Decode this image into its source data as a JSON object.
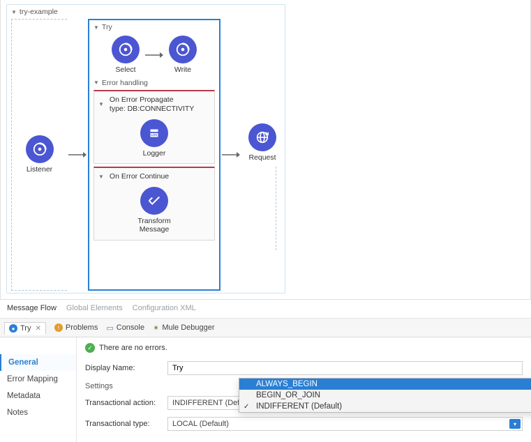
{
  "flow": {
    "name": "try-example",
    "listener_label": "Listener",
    "try_label": "Try",
    "select_label": "Select",
    "write_label": "Write",
    "error_handling_label": "Error handling",
    "on_error_propagate": {
      "title": "On Error Propagate",
      "type": "type: DB:CONNECTIVITY",
      "comp_label": "Logger"
    },
    "on_error_continue": {
      "title": "On Error Continue",
      "comp_label": "Transform\nMessage"
    },
    "request_label": "Request"
  },
  "bottom_tabs": {
    "t1": "Message Flow",
    "t2": "Global Elements",
    "t3": "Configuration XML"
  },
  "lower_tabs": {
    "try": "Try",
    "problems": "Problems",
    "console": "Console",
    "debugger": "Mule Debugger"
  },
  "status": {
    "msg": "There are no errors."
  },
  "side": {
    "general": "General",
    "error_mapping": "Error Mapping",
    "metadata": "Metadata",
    "notes": "Notes"
  },
  "form": {
    "display_name_lbl": "Display Name:",
    "display_name_val": "Try",
    "settings_lbl": "Settings",
    "tx_action_lbl": "Transactional action:",
    "tx_action_val": "INDIFFERENT (Default)",
    "tx_type_lbl": "Transactional type:",
    "tx_type_val": "LOCAL (Default)"
  },
  "dropdown": {
    "opt1": "ALWAYS_BEGIN",
    "opt2": "BEGIN_OR_JOIN",
    "opt3": "INDIFFERENT (Default)"
  }
}
